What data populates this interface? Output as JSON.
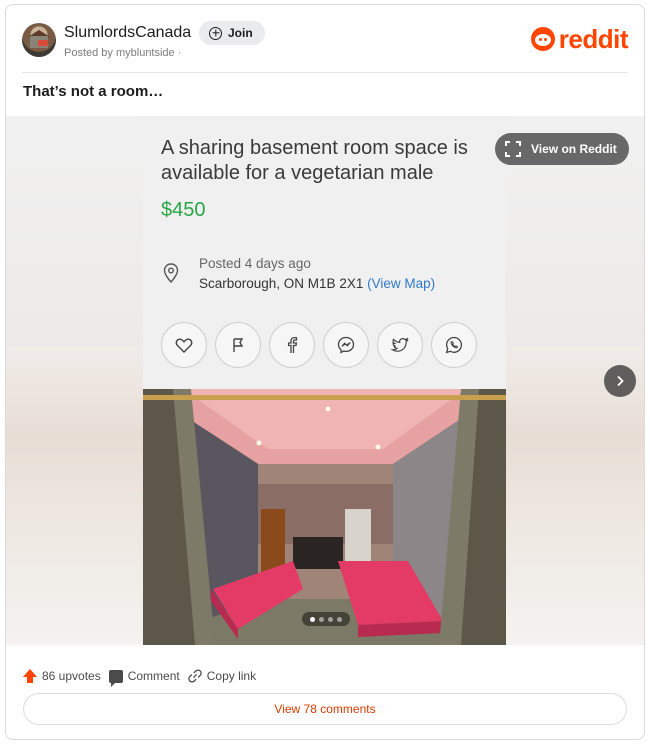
{
  "header": {
    "subreddit": "SlumlordsCanada",
    "posted_by": "Posted by mybluntside ·",
    "join_label": "Join",
    "logo_text": "reddit",
    "brand_color": "#ff4500"
  },
  "post": {
    "title": "That’s not a room…"
  },
  "media": {
    "view_on_reddit_label": "View on Reddit",
    "carousel": {
      "total": 4,
      "active": 1
    },
    "listing": {
      "title": "A sharing basement room space is available for a vegetarian male",
      "price": "$450",
      "posted_ago": "Posted 4 days ago",
      "location": "Scarborough, ON M1B 2X1",
      "view_map": "(View Map)",
      "share_icons": [
        "heart-icon",
        "flag-icon",
        "facebook-icon",
        "messenger-icon",
        "twitter-icon",
        "whatsapp-icon"
      ]
    }
  },
  "footer": {
    "upvotes": "86 upvotes",
    "comment": "Comment",
    "copy_link": "Copy link",
    "view_comments": "View 78 comments"
  }
}
